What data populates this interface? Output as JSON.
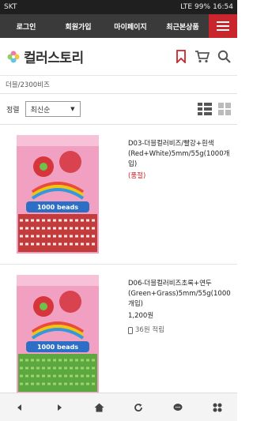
{
  "status_bar": {
    "carrier": "SKT",
    "battery": "99%",
    "time": "16:54",
    "network": "LTE"
  },
  "nav": {
    "items": [
      "로그인",
      "회원가입",
      "마이페이지",
      "최근본상품"
    ]
  },
  "header": {
    "logo_text": "컬러스토리"
  },
  "breadcrumb": "더블/2300비즈",
  "sort": {
    "label": "정렬",
    "selected": "최신순"
  },
  "products": [
    {
      "name": "D03-더블컬러비즈/빨강+흰색(Red+White)5mm/55g(1000개입)",
      "status": "(품절)",
      "pack_label": "1000 beads",
      "bead_color": "#c43b3b",
      "bead_color2": "#f2e9e9"
    },
    {
      "name": "D06-더블컬러비즈초록+연두(Green+Grass)5mm/55g(1000개입)",
      "price": "1,200원",
      "points": "36원 적립",
      "pack_label": "1000 beads",
      "bead_color": "#5aa83f",
      "bead_color2": "#9ed46a"
    }
  ],
  "colors": {
    "accent": "#c8262c",
    "nav_bg": "#3a3a3a"
  }
}
